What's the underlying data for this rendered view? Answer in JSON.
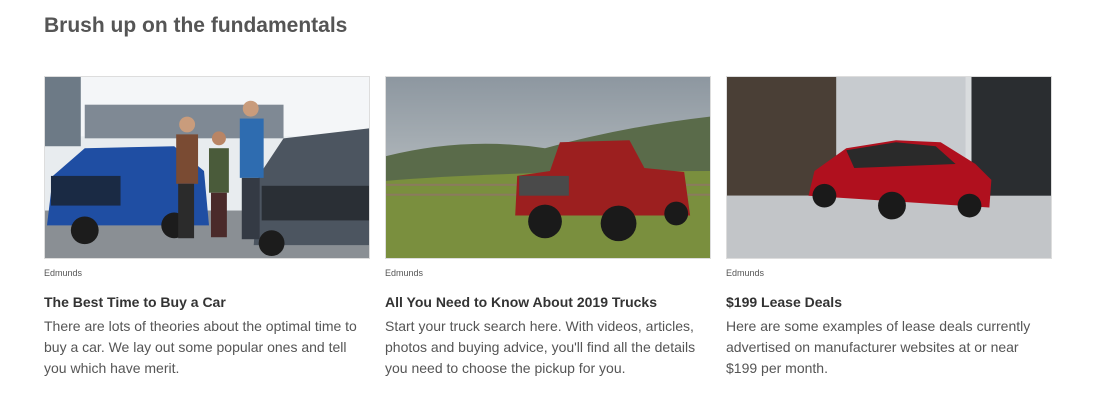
{
  "section": {
    "title": "Brush up on the fundamentals"
  },
  "cards": [
    {
      "image": "ford-dealership-photo",
      "source": "Edmunds",
      "title": "The Best Time to Buy a Car",
      "description": "There are lots of theories about the optimal time to buy a car. We lay out some popular ones and tell you which have merit."
    },
    {
      "image": "red-ram-pickup-photo",
      "source": "Edmunds",
      "title": "All You Need to Know About 2019 Trucks",
      "description": "Start your truck search here. With videos, articles, photos and buying advice, you'll find all the details you need to choose the pickup for you."
    },
    {
      "image": "red-mazda3-photo",
      "source": "Edmunds",
      "title": "$199 Lease Deals",
      "description": "Here are some examples of lease deals currently advertised on manufacturer websites at or near $199 per month."
    }
  ]
}
